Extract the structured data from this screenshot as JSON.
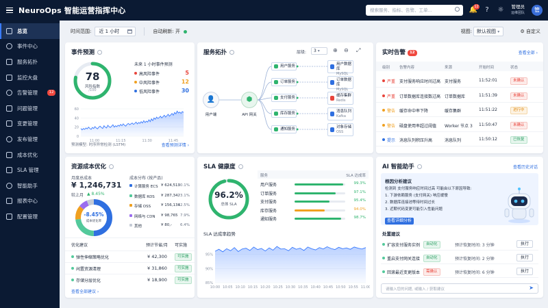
{
  "app": {
    "title": "NeuroOps 智能运营指挥中心",
    "search_placeholder": "搜索服务、指标、告警、工单...",
    "notif_count": "12",
    "user_name": "管理员",
    "user_role": "运维团队",
    "avatar": "管"
  },
  "nav": [
    {
      "label": "总览"
    },
    {
      "label": "事件中心"
    },
    {
      "label": "服务拓扑"
    },
    {
      "label": "监控大盘"
    },
    {
      "label": "告警管理",
      "badge": "12"
    },
    {
      "label": "问题管理"
    },
    {
      "label": "变更管理"
    },
    {
      "label": "发布管理"
    },
    {
      "label": "成本优化"
    },
    {
      "label": "SLA 管理"
    },
    {
      "label": "智能助手"
    },
    {
      "label": "报表中心"
    },
    {
      "label": "配置管理"
    }
  ],
  "filters": {
    "range_label": "时间范围:",
    "range_value": "近 1 小时",
    "auto_label": "自动刷新:",
    "auto_value": "开",
    "view_label": "视图:",
    "view_value": "默认视图",
    "custom": "自定义"
  },
  "event": {
    "title": "事件预测",
    "score": "78",
    "score_label": "风险指数",
    "score_max": "/100",
    "score_fraction": 0.78,
    "forecast_title": "未来 1 小时事件预测",
    "rows": [
      {
        "label": "高风险事件",
        "value": "5",
        "color": "#e8453c"
      },
      {
        "label": "中风险事件",
        "value": "12",
        "color": "#f0a020"
      },
      {
        "label": "低风险事件",
        "value": "30",
        "color": "#2f6fe0"
      }
    ],
    "model": "预测模型: 时序异常检测 (LSTM)",
    "detail_link": "查看预测详情 ›"
  },
  "event_chart": {
    "type": "area",
    "x": [
      "11:00",
      "11:15",
      "11:30",
      "11:45"
    ],
    "values": [
      17,
      14,
      17,
      15,
      18,
      16,
      20,
      17,
      15,
      19,
      17,
      21,
      18,
      16,
      20,
      22,
      19,
      17,
      23,
      20,
      18,
      24,
      21,
      19,
      22,
      25,
      20,
      23,
      21,
      24,
      22,
      26,
      23,
      27,
      24,
      22,
      26,
      28,
      25,
      27,
      29,
      26,
      28,
      31,
      27,
      30,
      28,
      32,
      29,
      34,
      30,
      33,
      31,
      36,
      32,
      38,
      34,
      40,
      37,
      42,
      39,
      41,
      44,
      40,
      43,
      46,
      42,
      45,
      48,
      44,
      47,
      50,
      46,
      52,
      49,
      55,
      51,
      53,
      50,
      54,
      52
    ],
    "ylim": [
      0,
      60
    ],
    "yticks": [
      0,
      20,
      40,
      60
    ],
    "color": "#3a7bff"
  },
  "topo": {
    "title": "服务拓扑",
    "level_label": "层级:",
    "level_value": "3",
    "user": "用户端",
    "gateway": "API 网关",
    "services": [
      "用户服务",
      "订单服务",
      "支付服务",
      "库存服务",
      "通知服务"
    ],
    "stores": [
      {
        "name": "用户数据库",
        "type": "MySQL",
        "color": "#2f6fe0"
      },
      {
        "name": "订单数据库",
        "type": "MySQL",
        "color": "#2f6fe0"
      },
      {
        "name": "缓存集群",
        "type": "Redis",
        "color": "#e8453c"
      },
      {
        "name": "消息队列",
        "type": "Kafka",
        "color": "#2f6fe0"
      },
      {
        "name": "对象存储",
        "type": "OSS",
        "color": "#2f6fe0"
      }
    ]
  },
  "alerts": {
    "title": "实时告警",
    "count": "12",
    "all_link": "查看全部 ›",
    "headers": [
      "级别",
      "告警内容",
      "来源",
      "开始时间",
      "状态"
    ],
    "rows": [
      {
        "level": "严重",
        "level_color": "#e8453c",
        "content": "支付服务响应时间过高",
        "source": "支付服务",
        "time": "11:52:01",
        "status": "未确认",
        "tag": "t-red"
      },
      {
        "level": "严重",
        "level_color": "#e8453c",
        "content": "订单数据库连接数过高",
        "source": "订单数据库",
        "time": "11:51:39",
        "status": "未确认",
        "tag": "t-red"
      },
      {
        "level": "警告",
        "level_color": "#f0a020",
        "content": "缓存命中率下降",
        "source": "缓存集群",
        "time": "11:51:22",
        "status": "进行中",
        "tag": "t-org"
      },
      {
        "level": "警告",
        "level_color": "#f0a020",
        "content": "磁盘使用率超过阈值",
        "source": "Worker 节点 3",
        "time": "11:50:47",
        "status": "未确认",
        "tag": "t-red"
      },
      {
        "level": "提示",
        "level_color": "#2f6fe0",
        "content": "消息队列积压升高",
        "source": "消息队列",
        "time": "11:50:12",
        "status": "已恢复",
        "tag": "t-grn"
      }
    ]
  },
  "cost": {
    "title": "资源成本优化",
    "month_label": "月度总成本",
    "month_value": "¥ 1,246,731",
    "compare": "较上月",
    "change": "▲ 8.45%",
    "donut_pct": "-8.45%",
    "donut_sub": "成本优化率",
    "dist_title": "成本分布 (按产品)",
    "dist": [
      {
        "name": "计算服务 ECS",
        "amount": "¥ 624,512",
        "pct": "50.1%",
        "value": 50.1,
        "color": "#2f6fe0"
      },
      {
        "name": "数据库 RDS",
        "amount": "¥ 287,342",
        "pct": "23.1%",
        "value": 23.1,
        "color": "#53c99b"
      },
      {
        "name": "存储 OSS",
        "amount": "¥ 156,134",
        "pct": "12.5%",
        "value": 12.5,
        "color": "#f0a020"
      },
      {
        "name": "网络与 CDN",
        "amount": "¥ 98,765",
        "pct": "7.9%",
        "value": 7.9,
        "color": "#9a6cf0"
      },
      {
        "name": "其他",
        "amount": "¥ 80,-",
        "pct": "6.4%",
        "value": 6.4,
        "color": "#c5cbd6"
      }
    ],
    "table_headers": [
      "优化建议",
      "预计节省/月",
      "可实施"
    ],
    "suggestions": [
      {
        "name": "弹性伸缩策略优化",
        "saving": "¥ 42,300",
        "action": "可实施"
      },
      {
        "name": "闲置资源清理",
        "saving": "¥ 31,860",
        "action": "可实施"
      },
      {
        "name": "存储分层优化",
        "saving": "¥ 18,900",
        "action": "可实施"
      }
    ],
    "all_link": "查看全部建议 ›"
  },
  "sla": {
    "title": "SLA 健康度",
    "overall": "96.2%",
    "overall_value": 96.2,
    "overall_label": "总体 SLA",
    "headers": [
      "服务",
      "SLA 达成率"
    ],
    "rows": [
      {
        "name": "用户服务",
        "pct": "99.3%",
        "value": 99.3,
        "color": "#2fb46e"
      },
      {
        "name": "订单服务",
        "pct": "97.1%",
        "value": 97.1,
        "color": "#2fb46e"
      },
      {
        "name": "支付服务",
        "pct": "95.4%",
        "value": 95.4,
        "color": "#2fb46e"
      },
      {
        "name": "库存服务",
        "pct": "94.0%",
        "value": 94.0,
        "color": "#f0a020"
      },
      {
        "name": "通知服务",
        "pct": "98.7%",
        "value": 98.7,
        "color": "#2fb46e"
      }
    ],
    "trend_title": "SLA 达成率趋势"
  },
  "sla_chart": {
    "type": "area",
    "x": [
      "10:00",
      "10:05",
      "10:10",
      "10:15",
      "10:20",
      "10:25",
      "10:30",
      "10:35",
      "10:40",
      "10:45",
      "10:50",
      "10:55",
      "11:00"
    ],
    "values": [
      96.1,
      96.8,
      95.9,
      97.0,
      96.3,
      97.4,
      96.0,
      96.9,
      97.2,
      96.4,
      97.6,
      96.7,
      97.1,
      96.2,
      97.3,
      96.5,
      97.8,
      96.9,
      97.0,
      96.3,
      97.5,
      96.8,
      97.2,
      96.4,
      97.6,
      97.0,
      96.6,
      97.4,
      96.9,
      97.7,
      97.1,
      96.7,
      97.5,
      97.0,
      97.3,
      96.8,
      97.6,
      97.2,
      96.9,
      97.4
    ],
    "ylim": [
      85,
      100
    ],
    "yticks": [
      "85%",
      "90%",
      "95%"
    ],
    "ytick_values": [
      85,
      90,
      95
    ],
    "color": "#3a7bff"
  },
  "ai": {
    "title": "AI 智能助手",
    "history_link": "查看历史对话",
    "root_title": "根因分析建议",
    "root_text": "检测到 支付服务响应时间过高 可能由以下原因导致:",
    "causes": [
      "1. 下游依赖服务 (支付网关) 响应缓慢",
      "2. 数据库连接池等待时间过长",
      "3. 近期代码变更可能引入性能问题"
    ],
    "analyze_btn": "查看详细分析",
    "disposal_title": "处置建议",
    "actions": [
      {
        "name": "扩容支付服务实例",
        "tag": "自动化",
        "tag_class": "t-grn",
        "eta": "预计恢复时间: 3 分钟",
        "btn": "执行"
      },
      {
        "name": "重启支付网关连接",
        "tag": "自动化",
        "tag_class": "t-grn",
        "eta": "预计恢复时间: 2 分钟",
        "btn": "执行"
      },
      {
        "name": "回滚最近变更版本",
        "tag": "需确认",
        "tag_class": "t-red",
        "eta": "预计恢复时间: 6 分钟",
        "btn": "执行"
      }
    ],
    "input_placeholder": "请输入您的问题, 或输入 / 获取建议"
  }
}
